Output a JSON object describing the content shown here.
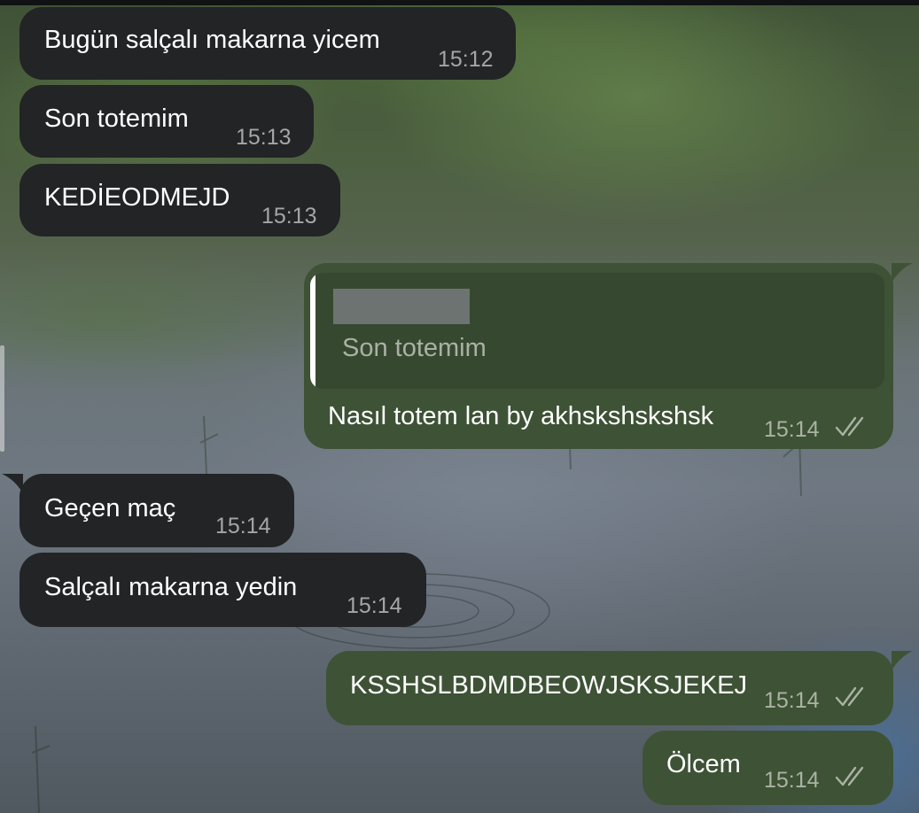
{
  "colors": {
    "incoming_bubble": "#222426",
    "outgoing_bubble": "#3e5236",
    "reply_box": "#364930",
    "time_text": "#a3a7a6"
  },
  "messages": [
    {
      "direction": "incoming",
      "text": "Bugün salçalı makarna yicem",
      "time": "15:12"
    },
    {
      "direction": "incoming",
      "text": "Son totemim",
      "time": "15:13"
    },
    {
      "direction": "incoming",
      "text": "KEDİEODMEJD",
      "time": "15:13"
    },
    {
      "direction": "outgoing",
      "reply_to": {
        "author": "(redacted)",
        "text": "Son totemim"
      },
      "text": "Nasıl totem lan by akhskshskshsk",
      "time": "15:14",
      "status_icon": "double-check-icon"
    },
    {
      "direction": "incoming",
      "text": "Geçen maç",
      "time": "15:14"
    },
    {
      "direction": "incoming",
      "text": "Salçalı makarna yedin",
      "time": "15:14"
    },
    {
      "direction": "outgoing",
      "text": "KSSHSLBDMDBEOWJSKSJEKEJ",
      "time": "15:14",
      "status_icon": "double-check-icon"
    },
    {
      "direction": "outgoing",
      "text": "Ölcem",
      "time": "15:14",
      "status_icon": "double-check-icon"
    }
  ]
}
